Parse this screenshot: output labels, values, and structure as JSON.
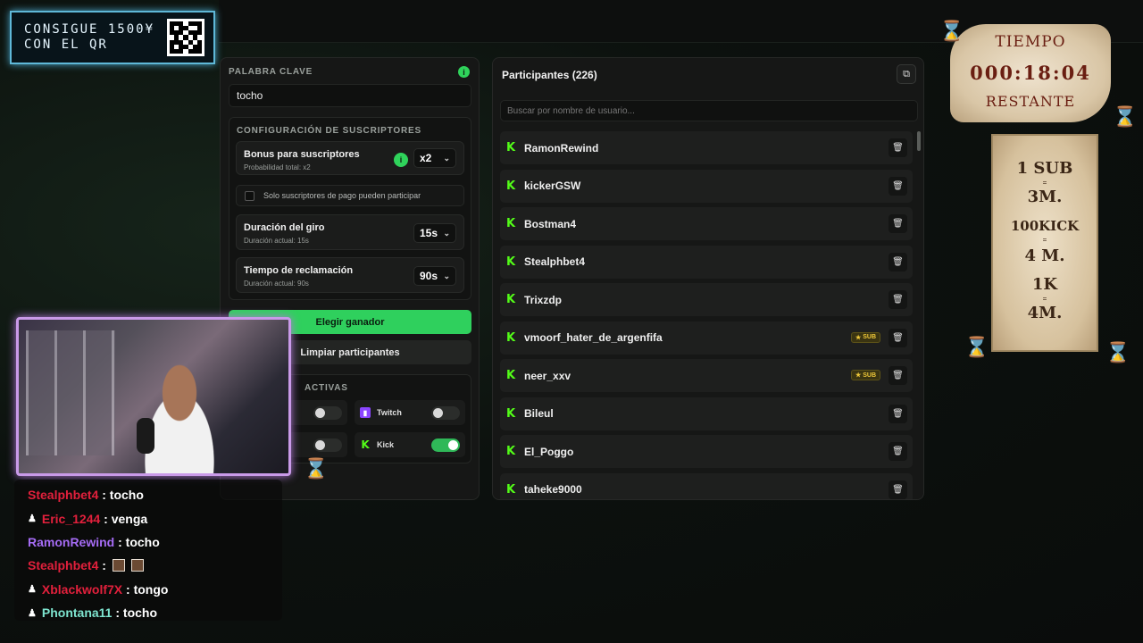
{
  "promo": {
    "text_line1": "CONSIGUE 1500¥",
    "text_line2": "CON EL QR"
  },
  "settings": {
    "keyword_title": "PALABRA CLAVE",
    "keyword_value": "tocho",
    "subs_title": "CONFIGURACIÓN DE SUSCRIPTORES",
    "bonus_label": "Bonus para suscriptores",
    "bonus_sub": "Probabilidad total: x2",
    "bonus_value": "x2",
    "only_paid_label": "Solo suscriptores de pago pueden participar",
    "spin_label": "Duración del giro",
    "spin_sub": "Duración actual: 15s",
    "spin_value": "15s",
    "claim_label": "Tiempo de reclamación",
    "claim_sub": "Duración actual: 90s",
    "claim_value": "90s",
    "pick_winner": "Elegir ganador",
    "clear_participants": "Limpiar participantes",
    "platforms_title": "ACTIVAS",
    "platform_twitch": "Twitch",
    "platform_kick": "Kick"
  },
  "participants": {
    "title": "Participantes (226)",
    "search_placeholder": "Buscar por nombre de usuario...",
    "sub_badge": "SUB",
    "items": [
      {
        "name": "RamonRewind",
        "sub": false
      },
      {
        "name": "kickerGSW",
        "sub": false
      },
      {
        "name": "Bostman4",
        "sub": false
      },
      {
        "name": "Stealphbet4",
        "sub": false
      },
      {
        "name": "Trixzdp",
        "sub": false
      },
      {
        "name": "vmoorf_hater_de_argenfifa",
        "sub": true
      },
      {
        "name": "neer_xxv",
        "sub": true
      },
      {
        "name": "Bileul",
        "sub": false
      },
      {
        "name": "El_Poggo",
        "sub": false
      },
      {
        "name": "taheke9000",
        "sub": false
      }
    ]
  },
  "chat": [
    {
      "user": "Stealphbet4",
      "msg": ": tocho"
    },
    {
      "user": "Eric_1244",
      "msg": ": venga"
    },
    {
      "user": "RamonRewind",
      "msg": ": tocho"
    },
    {
      "user": "Stealphbet4",
      "msg": ":"
    },
    {
      "user": "Xblackwolf7X",
      "msg": ": tongo"
    },
    {
      "user": "Phontana11",
      "msg": ": tocho"
    }
  ],
  "timer": {
    "top": "TIEMPO",
    "value": "000:18:04",
    "bottom": "RESTANTE"
  },
  "note": {
    "line1": "1 SUB",
    "line2": "3M.",
    "line3": "100KICK",
    "line4": "4 M.",
    "line5": "1K",
    "line6": "4M.",
    "sep": "="
  },
  "colors": {
    "accent_green": "#2fd05d",
    "kick_green": "#53fc18",
    "twitch_purple": "#8b46ff",
    "sub_gold": "#f0c93a"
  }
}
